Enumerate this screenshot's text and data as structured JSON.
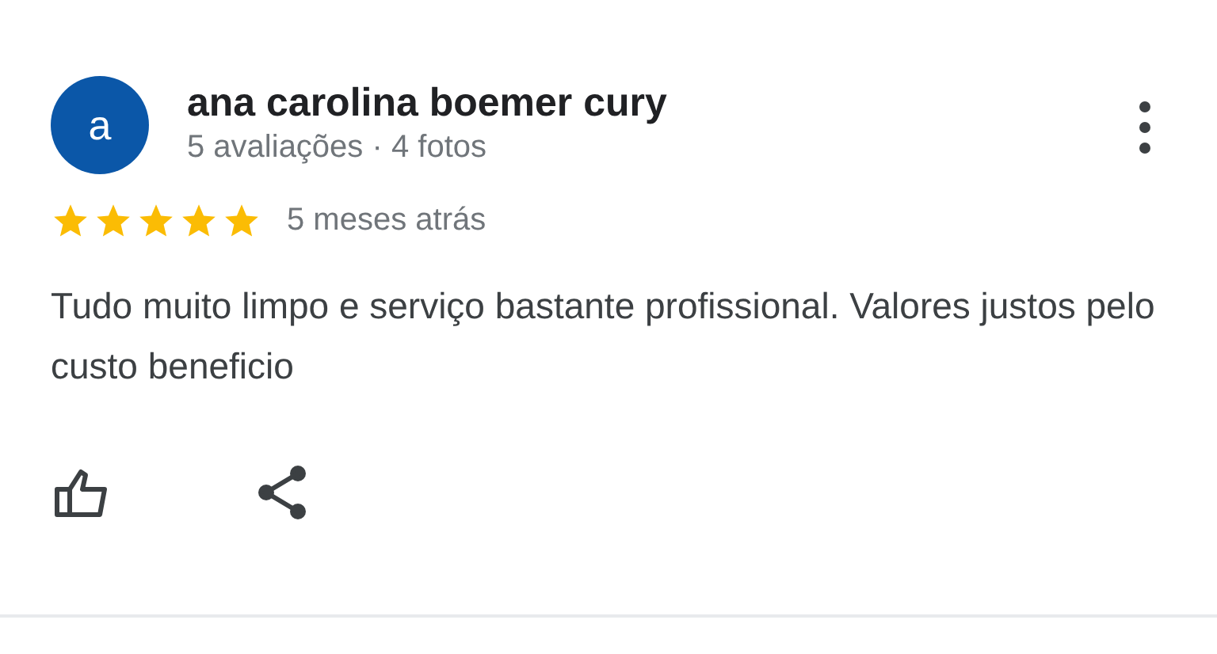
{
  "review": {
    "avatar_letter": "a",
    "author": "ana carolina boemer cury",
    "meta": "5 avaliações · 4 fotos",
    "stars": 5,
    "time": "5 meses atrás",
    "text": "Tudo muito limpo e serviço bastante profissional. Valores justos pelo custo beneficio"
  }
}
